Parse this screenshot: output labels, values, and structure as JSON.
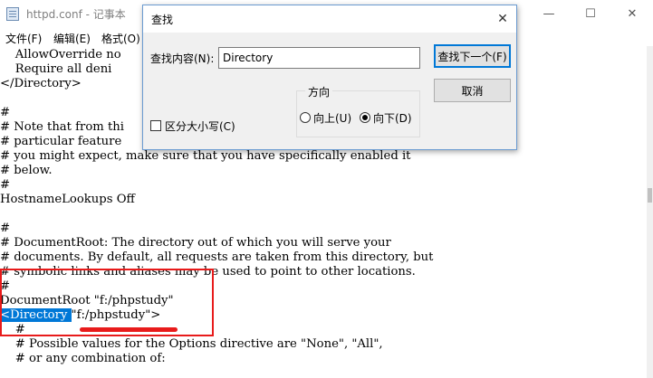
{
  "window": {
    "title": "httpd.conf - 记事本",
    "minimize_glyph": "—",
    "maximize_glyph": "☐",
    "close_glyph": "✕"
  },
  "menu": [
    "文件(F)",
    "编辑(E)",
    "格式(O)"
  ],
  "editor": {
    "lines": [
      "    AllowOverride no",
      "    Require all deni",
      "</Directory>",
      "",
      "#",
      "# Note that from thi",
      "# particular feature",
      "# you might expect, make sure that you have specifically enabled it",
      "# below.",
      "#",
      "HostnameLookups Off",
      "",
      "#",
      "# DocumentRoot: The directory out of which you will serve your",
      "# documents. By default, all requests are taken from this directory, but",
      "# symbolic links and aliases may be used to point to other locations.",
      "#",
      "DocumentRoot \"f:/phpstudy\"",
      "",
      "    #",
      "    # Possible values for the Options directive are \"None\", \"All\",",
      "    # or any combination of:"
    ],
    "match_line": {
      "selected": "<Directory ",
      "rest": "\"f:/phpstudy\">"
    }
  },
  "find_dialog": {
    "title": "查找",
    "find_label": "查找内容(N):",
    "find_value": "Directory",
    "find_next_button": "查找下一个(F)",
    "cancel_button": "取消",
    "direction_label": "方向",
    "up_label": "向上(U)",
    "down_label": "向下(D)",
    "direction_selected": "down",
    "match_case_label": "区分大小写(C)",
    "match_case_checked": false
  },
  "annotation_color": "#e81b1b",
  "selection_color": "#0078d7"
}
